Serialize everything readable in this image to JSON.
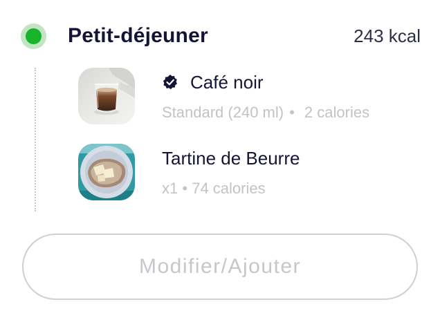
{
  "meal": {
    "title": "Petit-déjeuner",
    "kcal": "243 kcal",
    "status_color": "#18b32a"
  },
  "items": [
    {
      "name": "Café noir",
      "verified": true,
      "verified_icon": "verified-badge-icon",
      "portion": "Standard (240 ml)",
      "separator": "•",
      "calories": "2 calories",
      "image": "coffee-glass-image"
    },
    {
      "name": "Tartine de Beurre",
      "verified": false,
      "portion": "x1",
      "separator": "•",
      "calories": "74 calories",
      "image": "bread-butter-plate-image"
    }
  ],
  "action": {
    "label": "Modifier/Ajouter"
  }
}
